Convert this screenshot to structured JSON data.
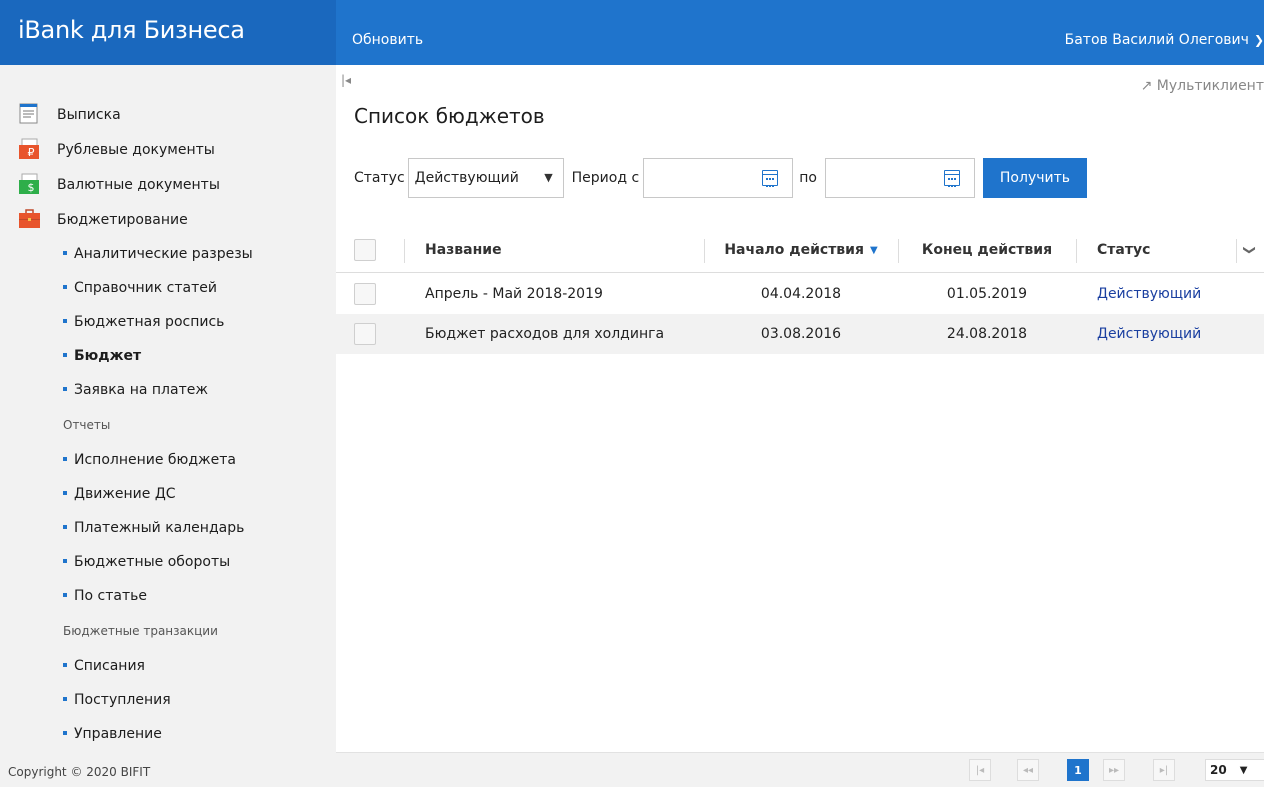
{
  "header": {
    "brand": "iBank для Бизнеса",
    "refresh": "Обновить",
    "user": "Батов Василий Олегович"
  },
  "colors": {
    "accent": "#1f74cc",
    "sidebar_bg": "#f2f2f2",
    "status_link": "#1a3fa0"
  },
  "sidebar": {
    "main_items": [
      {
        "label": "Выписка",
        "icon": "statement-icon"
      },
      {
        "label": "Рублевые документы",
        "icon": "ruble-documents-icon"
      },
      {
        "label": "Валютные документы",
        "icon": "currency-documents-icon"
      },
      {
        "label": "Бюджетирование",
        "icon": "budgeting-briefcase-icon"
      }
    ],
    "budget_items": [
      "Аналитические разрезы",
      "Справочник статей",
      "Бюджетная роспись",
      "Бюджет",
      "Заявка на платеж"
    ],
    "reports_group": "Отчеты",
    "report_items": [
      "Исполнение бюджета",
      "Движение ДС",
      "Платежный календарь",
      "Бюджетные обороты",
      "По статье"
    ],
    "transactions_group": "Бюджетные транзакции",
    "transaction_items": [
      "Списания",
      "Поступления",
      "Управление"
    ],
    "active_item": "Бюджет",
    "copyright": "Copyright © 2020 BIFIT"
  },
  "main": {
    "multiclient": "Мультиклиент",
    "title": "Список бюджетов",
    "filters": {
      "status_label": "Статус",
      "status_value": "Действующий",
      "period_from_label": "Период с",
      "period_to_label": "по",
      "date_from": "",
      "date_to": "",
      "get_button": "Получить"
    },
    "table": {
      "columns": [
        "Название",
        "Начало действия",
        "Конец действия",
        "Статус"
      ],
      "sorted_column": "Начало действия",
      "rows": [
        {
          "name": "Апрель - Май 2018-2019",
          "start": "04.04.2018",
          "end": "01.05.2019",
          "status": "Действующий"
        },
        {
          "name": "Бюджет расходов для холдинга",
          "start": "03.08.2016",
          "end": "24.08.2018",
          "status": "Действующий"
        }
      ]
    },
    "pager": {
      "current_page": "1",
      "per_page": "20"
    }
  }
}
